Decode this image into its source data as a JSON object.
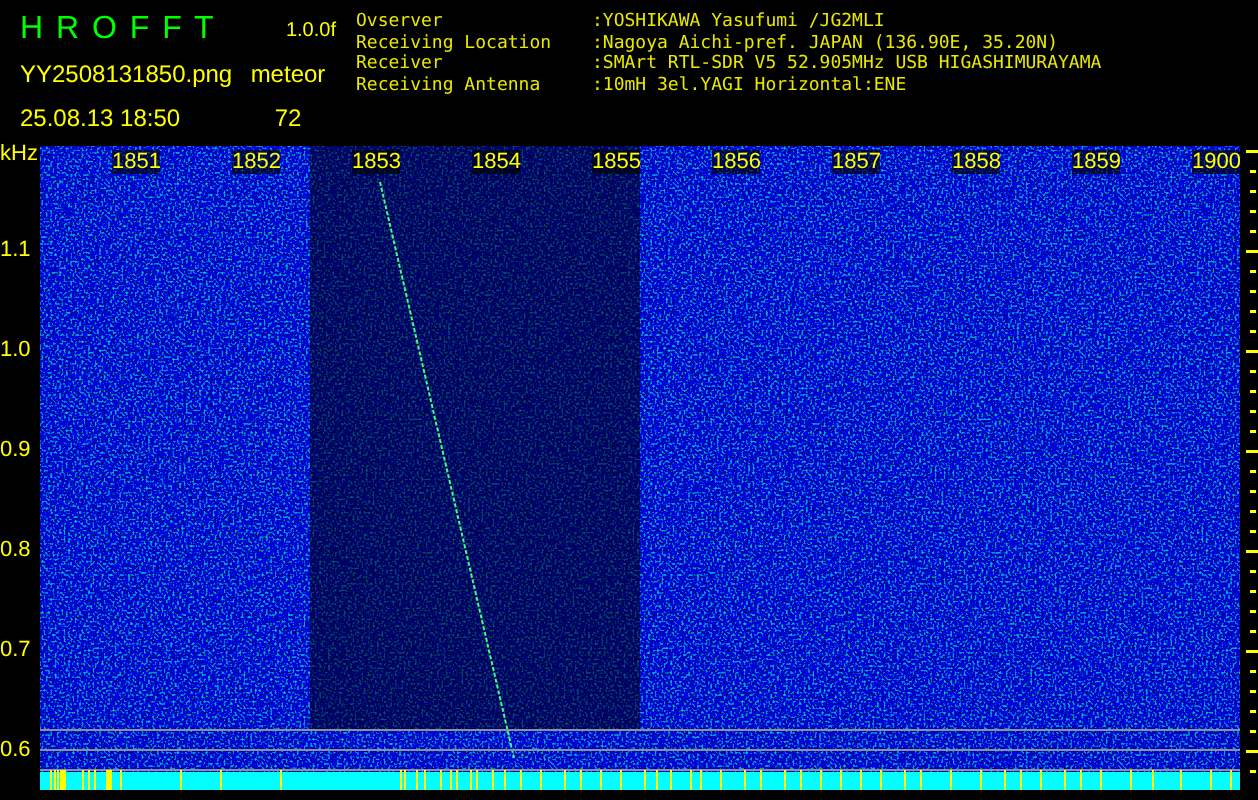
{
  "header": {
    "app_title": "H R O F F T",
    "version": "1.0.0f",
    "filename": "YY2508131850.png",
    "timestamp": "25.08.13 18:50",
    "event_label": "meteor",
    "event_count": "72",
    "info": [
      {
        "label": "Ovserver",
        "value": ":YOSHIKAWA Yasufumi /JG2MLI"
      },
      {
        "label": "Receiving Location",
        "value": ":Nagoya Aichi-pref. JAPAN (136.90E, 35.20N)"
      },
      {
        "label": "Receiver",
        "value": ":SMArt RTL-SDR V5 52.905MHz USB HIGASHIMURAYAMA"
      },
      {
        "label": "Receiving Antenna",
        "value": ":10mH 3el.YAGI Horizontal:ENE"
      }
    ]
  },
  "spectrogram": {
    "unit": "kHz",
    "time_labels": [
      "1851",
      "1852",
      "1853",
      "1854",
      "1855",
      "1856",
      "1857",
      "1858",
      "1859",
      "1900"
    ],
    "freq_labels": [
      "1.1",
      "1.0",
      "0.9",
      "0.8",
      "0.7",
      "0.6"
    ]
  }
}
